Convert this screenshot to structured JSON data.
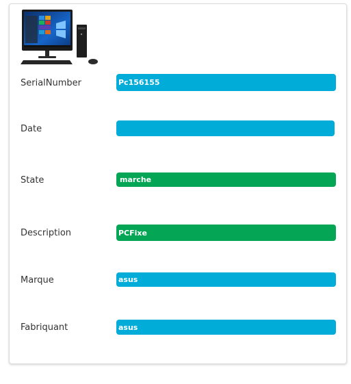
{
  "fields": {
    "serial_number": {
      "label": "SerialNumber",
      "value": "Pc156155"
    },
    "date": {
      "label": "Date",
      "value": ""
    },
    "state": {
      "label": "State",
      "value": "marche"
    },
    "description": {
      "label": "Description",
      "value": "PCFixe"
    },
    "marque": {
      "label": "Marque",
      "value": "asus"
    },
    "fabriquant": {
      "label": "Fabriquant",
      "value": "asus"
    }
  },
  "colors": {
    "badge_blue": "#02acd9",
    "badge_green": "#04a656"
  },
  "image": {
    "icon": "desktop-computer-icon"
  }
}
